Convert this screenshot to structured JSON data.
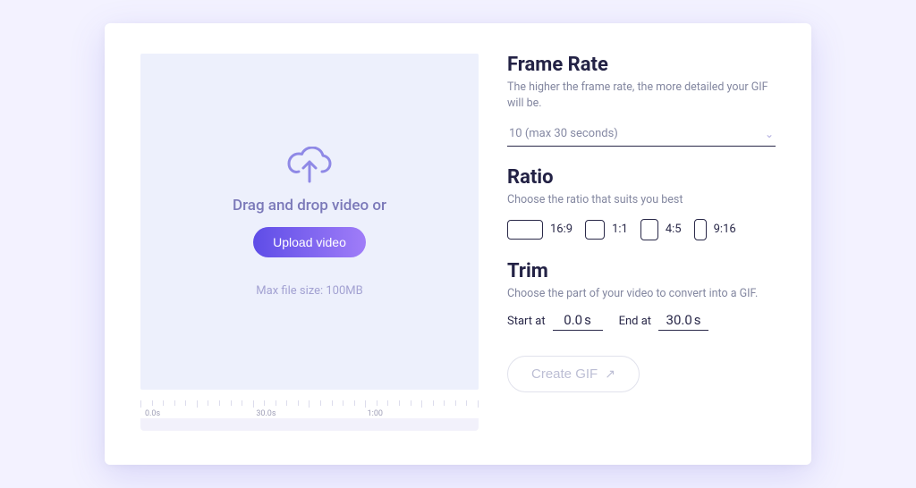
{
  "drop": {
    "drag_text": "Drag and drop video or",
    "upload_label": "Upload video",
    "max_size": "Max file size: 100MB"
  },
  "timeline": {
    "labels": [
      "0.0s",
      "30.0s",
      "1:00"
    ]
  },
  "sections": {
    "frame_rate": {
      "title": "Frame Rate",
      "hint": "The higher the frame rate, the more detailed your GIF will be.",
      "select_value": "10 (max 30 seconds)"
    },
    "ratio": {
      "title": "Ratio",
      "hint": "Choose the ratio that suits you best",
      "options": [
        "16:9",
        "1:1",
        "4:5",
        "9:16"
      ]
    },
    "trim": {
      "title": "Trim",
      "hint": "Choose the part of your video to convert into a GIF.",
      "start_label": "Start at",
      "start_value": "0.0",
      "end_label": "End at",
      "end_value": "30.0",
      "unit": "s"
    }
  },
  "action": {
    "create_label": "Create GIF"
  }
}
